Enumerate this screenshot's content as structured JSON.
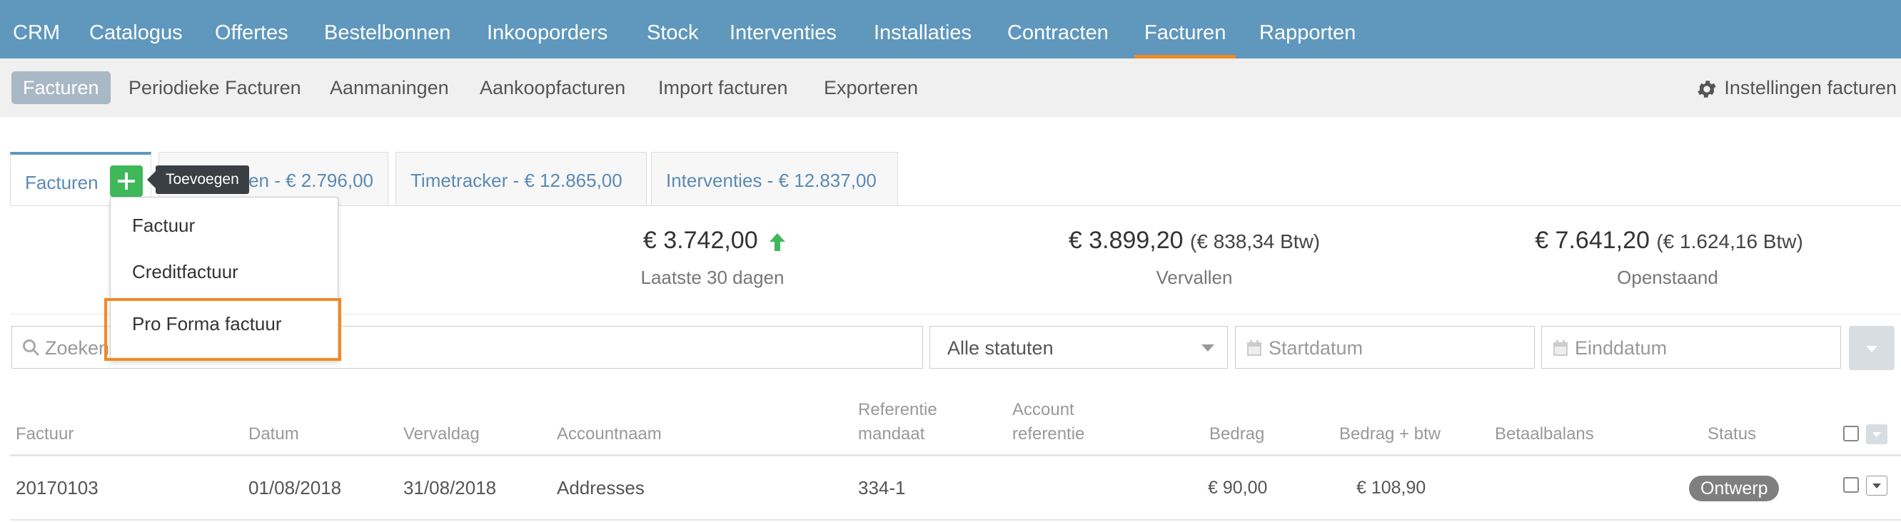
{
  "topnav": {
    "items": [
      "CRM",
      "Catalogus",
      "Offertes",
      "Bestelbonnen",
      "Inkooporders",
      "Stock",
      "Interventies",
      "Installaties",
      "Contracten",
      "Facturen",
      "Rapporten"
    ],
    "active": "Facturen",
    "bg_color": "#5f97bd",
    "accent_color": "#f08a24"
  },
  "subnav": {
    "items": [
      "Facturen",
      "Periodieke Facturen",
      "Aanmaningen",
      "Aankoopfacturen",
      "Import facturen",
      "Exporteren"
    ],
    "active": "Facturen",
    "settings_label": "Instellingen facturen",
    "settings_icon": "gear-icon"
  },
  "tabs": {
    "items": [
      "Facturen",
      "en - € 2.796,00",
      "Timetracker - € 12.865,00",
      "Interventies - € 12.837,00"
    ],
    "add_tooltip": "Toevoegen",
    "add_icon": "plus-icon",
    "add_color": "#3fb85a"
  },
  "dropdown": {
    "items": [
      "Factuur",
      "Creditfactuur",
      "Pro Forma factuur"
    ],
    "highlighted": "Pro Forma factuur"
  },
  "stats": [
    {
      "value": "€ 3.742,00",
      "extra": "",
      "label": "Laatste 30 dagen",
      "trend_icon": "arrow-up-icon"
    },
    {
      "value": "€ 3.899,20",
      "extra": "(€ 838,34 Btw)",
      "label": "Vervallen"
    },
    {
      "value": "€ 7.641,20",
      "extra": "(€ 1.624,16 Btw)",
      "label": "Openstaand"
    }
  ],
  "filters": {
    "search_placeholder": "Zoeken",
    "status_value": "Alle statuten",
    "start_placeholder": "Startdatum",
    "end_placeholder": "Einddatum"
  },
  "table": {
    "headers": {
      "factuur": "Factuur",
      "datum": "Datum",
      "vervaldag": "Vervaldag",
      "accountnaam": "Accountnaam",
      "referentie_1": "Referentie",
      "referentie_2": "mandaat",
      "account_1": "Account",
      "account_2": "referentie",
      "bedrag": "Bedrag",
      "bedrag_btw": "Bedrag + btw",
      "betaalbalans": "Betaalbalans",
      "status": "Status"
    },
    "rows": [
      {
        "factuur": "20170103",
        "datum": "01/08/2018",
        "vervaldag": "31/08/2018",
        "accountnaam": "Addresses",
        "referentie": "334-1",
        "account": "",
        "bedrag": "€ 90,00",
        "bedrag_btw": "€ 108,90",
        "betaalbalans": "",
        "status": "Ontwerp"
      }
    ]
  }
}
